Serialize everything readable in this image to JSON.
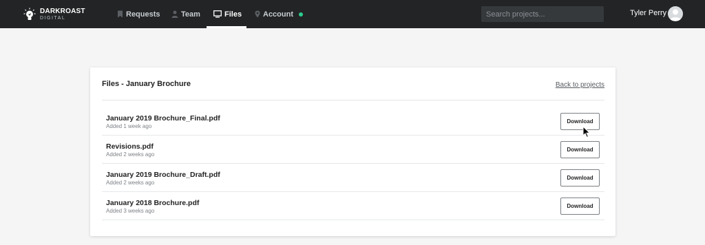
{
  "brand": {
    "name_line1": "DARKROAST",
    "name_line2": "DIGITAL"
  },
  "nav": {
    "items": [
      {
        "label": "Requests",
        "icon": "bookmark-icon"
      },
      {
        "label": "Team",
        "icon": "person-icon"
      },
      {
        "label": "Files",
        "icon": "monitor-icon",
        "active": true
      },
      {
        "label": "Account",
        "icon": "map-pin-icon",
        "status_color": "#2ecc8f"
      }
    ]
  },
  "search": {
    "placeholder": "Search projects..."
  },
  "user": {
    "name": "Tyler Perry"
  },
  "page": {
    "title": "Files - January Brochure",
    "back_link": "Back to projects",
    "files": [
      {
        "name": "January 2019 Brochure_Final.pdf",
        "added": "Added 1 week ago",
        "action": "Download"
      },
      {
        "name": "Revisions.pdf",
        "added": "Added 2 weeks ago",
        "action": "Download"
      },
      {
        "name": "January 2019 Brochure_Draft.pdf",
        "added": "Added 2 weeks ago",
        "action": "Download"
      },
      {
        "name": "January 2018 Brochure.pdf",
        "added": "Added 3 weeks ago",
        "action": "Download"
      }
    ]
  },
  "colors": {
    "topbar": "#222426",
    "accent_status": "#2ecc8f",
    "background": "#f5f5f6"
  }
}
